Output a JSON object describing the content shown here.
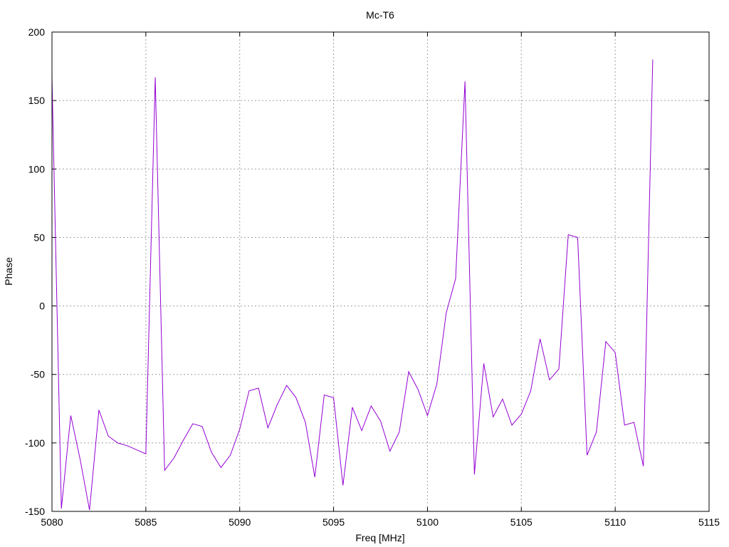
{
  "chart_data": {
    "type": "line",
    "title": "Mc-T6",
    "xlabel": "Freq [MHz]",
    "ylabel": "Phase",
    "xlim": [
      5080,
      5115
    ],
    "ylim": [
      -150,
      200
    ],
    "xticks": [
      5080,
      5085,
      5090,
      5095,
      5100,
      5105,
      5110,
      5115
    ],
    "yticks": [
      -150,
      -100,
      -50,
      0,
      50,
      100,
      150,
      200
    ],
    "grid": true,
    "legend": "none",
    "color": "#9400d3",
    "series": [
      {
        "x": [
          5080.0,
          5080.5,
          5081.0,
          5081.5,
          5082.0,
          5082.5,
          5083.0,
          5083.5,
          5084.0,
          5084.5,
          5085.0,
          5085.5,
          5086.0,
          5086.5,
          5087.0,
          5087.5,
          5088.0,
          5088.5,
          5089.0,
          5089.5,
          5090.0,
          5090.5,
          5091.0,
          5091.5,
          5092.0,
          5092.5,
          5093.0,
          5093.5,
          5094.0,
          5094.5,
          5095.0,
          5095.5,
          5096.0,
          5096.5,
          5097.0,
          5097.5,
          5098.0,
          5098.5,
          5099.0,
          5099.5,
          5100.0,
          5100.5,
          5101.0,
          5101.5,
          5102.0,
          5102.5,
          5103.0,
          5103.5,
          5104.0,
          5104.5,
          5105.0,
          5105.5,
          5106.0,
          5106.5,
          5107.0,
          5107.5,
          5108.0,
          5108.5,
          5109.0,
          5109.5,
          5110.0,
          5110.5,
          5111.0,
          5111.5,
          5112.0
        ],
        "y": [
          167,
          -148,
          -80,
          -112,
          -149,
          -76,
          -95,
          -100,
          -102,
          -105,
          -108,
          167,
          -120,
          -111,
          -98,
          -86,
          -88,
          -107,
          -118,
          -109,
          -90,
          -62,
          -60,
          -89,
          -72,
          -58,
          -67,
          -85,
          -125,
          -65,
          -67,
          -131,
          -74,
          -91,
          -73,
          -84,
          -106,
          -92,
          -48,
          -61,
          -80,
          -57,
          -5,
          20,
          164,
          -123,
          -42,
          -81,
          -68,
          -87,
          -79,
          -62,
          -24,
          -54,
          -46,
          52,
          50,
          -109,
          -92,
          -26,
          -34,
          -87,
          -85,
          -117,
          180
        ]
      }
    ]
  }
}
